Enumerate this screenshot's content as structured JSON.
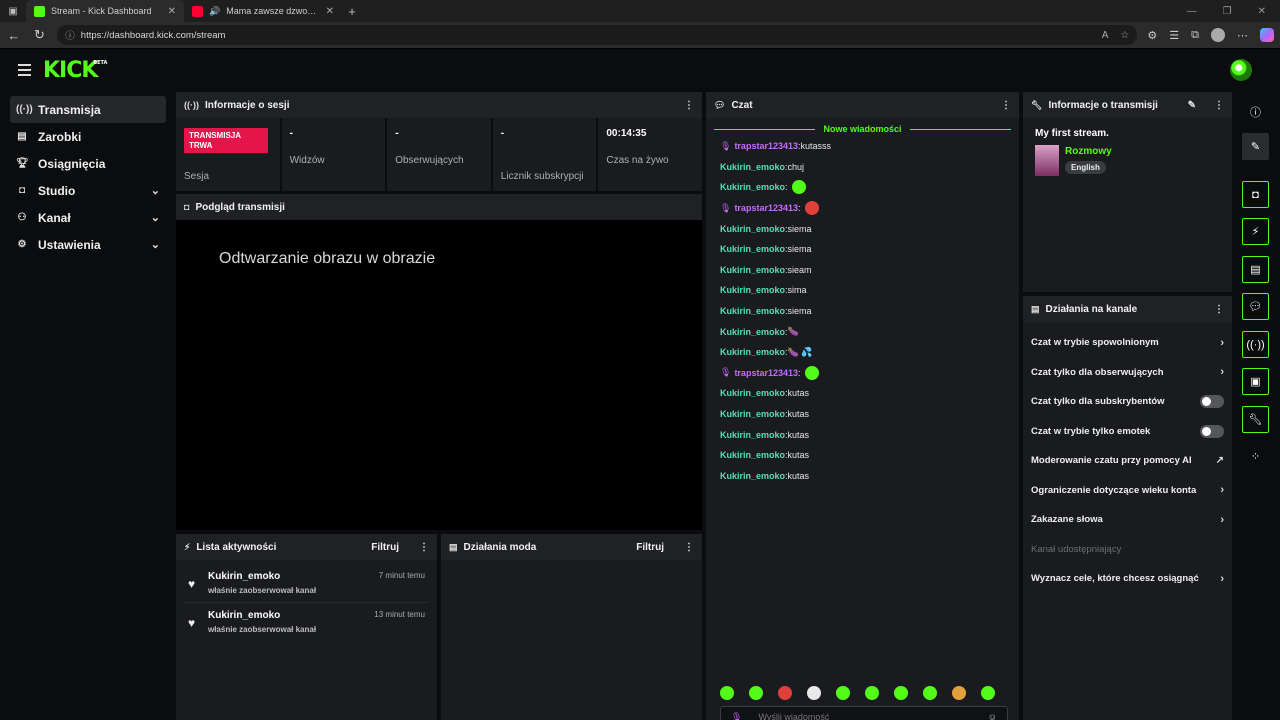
{
  "browser": {
    "tabs": [
      {
        "title": "Stream - Kick Dashboard",
        "active": true,
        "favicon_color": "#53fc18"
      },
      {
        "title": "Mama zawsze dzwoni w idealnym momencie",
        "active": false,
        "favicon_color": "#ff0033"
      }
    ],
    "url": "https://dashboard.kick.com/stream"
  },
  "app": {
    "logo": "KICK",
    "logo_badge": "BETA",
    "accent": "#53fc18"
  },
  "sidebar": {
    "items": [
      {
        "label": "Transmisja",
        "icon": "broadcast-icon",
        "active": true,
        "expandable": false
      },
      {
        "label": "Zarobki",
        "icon": "earnings-icon",
        "active": false,
        "expandable": false
      },
      {
        "label": "Osiągnięcia",
        "icon": "trophy-icon",
        "active": false,
        "expandable": false
      },
      {
        "label": "Studio",
        "icon": "studio-icon",
        "active": false,
        "expandable": true
      },
      {
        "label": "Kanał",
        "icon": "channel-icon",
        "active": false,
        "expandable": true
      },
      {
        "label": "Ustawienia",
        "icon": "gear-icon",
        "active": false,
        "expandable": true
      }
    ]
  },
  "session": {
    "title": "Informacje o sesji",
    "status_badge": "TRANSMISJA TRWA",
    "session_label": "Sesja",
    "viewers_value": "-",
    "viewers_label": "Widzów",
    "followers_value": "-",
    "followers_label": "Obserwujących",
    "subs_value": "-",
    "subs_label": "Licznik subskrypcji",
    "live_time": "00:14:35",
    "live_time_label": "Czas na żywo"
  },
  "preview": {
    "title": "Podgląd transmisji",
    "pip_text": "Odtwarzanie obrazu w obrazie"
  },
  "activity": {
    "title": "Lista aktywności",
    "filter": "Filtruj",
    "items": [
      {
        "user": "Kukirin_emoko",
        "action": "właśnie zaobserwował kanał",
        "time": "7 minut temu"
      },
      {
        "user": "Kukirin_emoko",
        "action": "właśnie zaobserwował kanał",
        "time": "13 minut temu"
      }
    ]
  },
  "mod_actions": {
    "title": "Działania moda",
    "filter": "Filtruj"
  },
  "chat": {
    "title": "Czat",
    "new_messages": "Nowe wiadomości",
    "input_placeholder": "Wyślij wiadomość",
    "messages": [
      {
        "user": "trapstar123413",
        "text": "kutasss",
        "color": "#c76bff",
        "mic": true,
        "emotes": []
      },
      {
        "user": "Kukirin_emoko",
        "text": "chuj",
        "color": "#53e0b4",
        "mic": false,
        "emotes": []
      },
      {
        "user": "Kukirin_emoko",
        "text": "",
        "color": "#53e0b4",
        "mic": false,
        "emotes": [
          "#53fc18"
        ]
      },
      {
        "user": "trapstar123413",
        "text": "",
        "color": "#c76bff",
        "mic": true,
        "emotes": [
          "#e0403a"
        ]
      },
      {
        "user": "Kukirin_emoko",
        "text": "siema",
        "color": "#53e0b4",
        "mic": false,
        "emotes": []
      },
      {
        "user": "Kukirin_emoko",
        "text": "siema",
        "color": "#53e0b4",
        "mic": false,
        "emotes": []
      },
      {
        "user": "Kukirin_emoko",
        "text": "sieam",
        "color": "#53e0b4",
        "mic": false,
        "emotes": []
      },
      {
        "user": "Kukirin_emoko",
        "text": "sima",
        "color": "#53e0b4",
        "mic": false,
        "emotes": []
      },
      {
        "user": "Kukirin_emoko",
        "text": "siema",
        "color": "#53e0b4",
        "mic": false,
        "emotes": []
      },
      {
        "user": "Kukirin_emoko",
        "text": "🍆",
        "color": "#53e0b4",
        "mic": false,
        "emotes": []
      },
      {
        "user": "Kukirin_emoko",
        "text": "🍆 💦",
        "color": "#53e0b4",
        "mic": false,
        "emotes": []
      },
      {
        "user": "trapstar123413",
        "text": "",
        "color": "#c76bff",
        "mic": true,
        "emotes": [
          "#53fc18"
        ]
      },
      {
        "user": "Kukirin_emoko",
        "text": "kutas",
        "color": "#53e0b4",
        "mic": false,
        "emotes": []
      },
      {
        "user": "Kukirin_emoko",
        "text": "kutas",
        "color": "#53e0b4",
        "mic": false,
        "emotes": []
      },
      {
        "user": "Kukirin_emoko",
        "text": "kutas",
        "color": "#53e0b4",
        "mic": false,
        "emotes": []
      },
      {
        "user": "Kukirin_emoko",
        "text": "kutas",
        "color": "#53e0b4",
        "mic": false,
        "emotes": []
      },
      {
        "user": "Kukirin_emoko",
        "text": "kutas",
        "color": "#53e0b4",
        "mic": false,
        "emotes": []
      }
    ],
    "quick_emotes": [
      "#53fc18",
      "#53fc18",
      "#e0403a",
      "#e8e8e8",
      "#53fc18",
      "#53fc18",
      "#53fc18",
      "#53fc18",
      "#e0a03a",
      "#53fc18"
    ]
  },
  "stream_info": {
    "title": "Informacje o transmisji",
    "stream_title": "My first stream.",
    "category": "Rozmowy",
    "language": "English"
  },
  "channel_actions": {
    "title": "Działania na kanale",
    "items": [
      {
        "label": "Czat w trybie spowolnionym",
        "control": "chevron"
      },
      {
        "label": "Czat tylko dla obserwujących",
        "control": "chevron"
      },
      {
        "label": "Czat tylko dla subskrybentów",
        "control": "toggle"
      },
      {
        "label": "Czat w trybie tylko emotek",
        "control": "toggle"
      },
      {
        "label": "Moderowanie czatu przy pomocy AI",
        "control": "external"
      },
      {
        "label": "Ograniczenie dotyczące wieku konta",
        "control": "chevron"
      },
      {
        "label": "Zakazane słowa",
        "control": "chevron"
      },
      {
        "label": "Kanał udostępniający",
        "control": "disabled"
      },
      {
        "label": "Wyznacz cele, które chcesz osiągnąć",
        "control": "chevron"
      }
    ]
  }
}
